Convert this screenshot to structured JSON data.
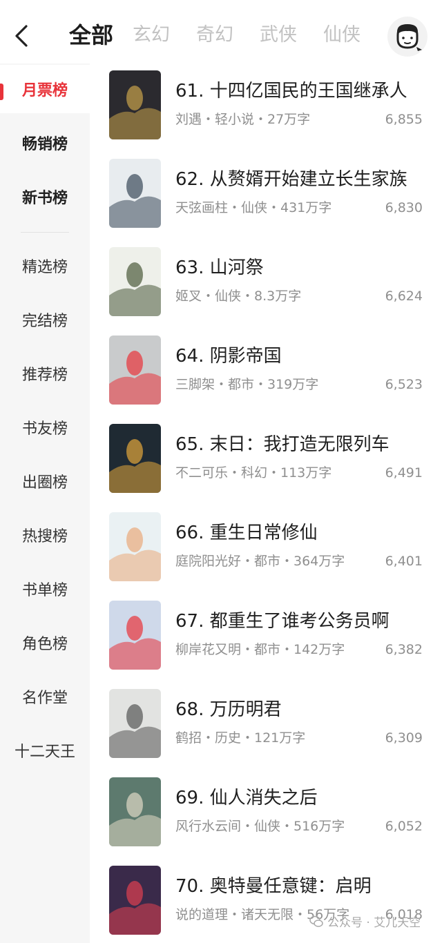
{
  "header": {
    "tabs": [
      {
        "label": "全部",
        "active": true
      },
      {
        "label": "玄幻"
      },
      {
        "label": "奇幻"
      },
      {
        "label": "武侠"
      },
      {
        "label": "仙侠"
      }
    ],
    "back_icon": "chevron-left-icon",
    "avatar_icon": "user-avatar-icon"
  },
  "sidebar": {
    "items": [
      {
        "label": "月票榜",
        "active": true
      },
      {
        "label": "畅销榜"
      },
      {
        "label": "新书榜"
      },
      {
        "label": "精选榜"
      },
      {
        "label": "完结榜"
      },
      {
        "label": "推荐榜"
      },
      {
        "label": "书友榜"
      },
      {
        "label": "出圈榜"
      },
      {
        "label": "热搜榜"
      },
      {
        "label": "书单榜"
      },
      {
        "label": "角色榜"
      },
      {
        "label": "名作堂"
      },
      {
        "label": "十二天王"
      }
    ]
  },
  "books": [
    {
      "title": "61. 十四亿国民的王国继承人",
      "meta": "刘遇・轻小说・27万字",
      "count": "6,855",
      "cover_color": "#2b2a2f",
      "cover_accent": "#c9a24a"
    },
    {
      "title": "62. 从赘婿开始建立长生家族",
      "meta": "天弦画柱・仙侠・431万字",
      "count": "6,830",
      "cover_color": "#e8ecef",
      "cover_accent": "#3a4a5a"
    },
    {
      "title": "63. 山河祭",
      "meta": "姬叉・仙侠・8.3万字",
      "count": "6,624",
      "cover_color": "#eef0ea",
      "cover_accent": "#4b5a3a"
    },
    {
      "title": "64. 阴影帝国",
      "meta": "三脚架・都市・319万字",
      "count": "6,523",
      "cover_color": "#c9cbcc",
      "cover_accent": "#e8333a"
    },
    {
      "title": "65. 末日：我打造无限列车",
      "meta": "不二可乐・科幻・113万字",
      "count": "6,491",
      "cover_color": "#1f2a33",
      "cover_accent": "#e2a63a"
    },
    {
      "title": "66. 重生日常修仙",
      "meta": "庭院阳光好・都市・364万字",
      "count": "6,401",
      "cover_color": "#eaf1f3",
      "cover_accent": "#e9a97a"
    },
    {
      "title": "67. 都重生了谁考公务员啊",
      "meta": "柳岸花又明・都市・142万字",
      "count": "6,382",
      "cover_color": "#cfd9ea",
      "cover_accent": "#e8333a"
    },
    {
      "title": "68. 万历明君",
      "meta": "鹤招・历史・121万字",
      "count": "6,309",
      "cover_color": "#e2e3e1",
      "cover_accent": "#555"
    },
    {
      "title": "69. 仙人消失之后",
      "meta": "风行水云间・仙侠・516万字",
      "count": "6,052",
      "cover_color": "#5d7a6e",
      "cover_accent": "#e0d8c5"
    },
    {
      "title": "70. 奥特曼任意键：启明",
      "meta": "说的道理・诸天无限・56万字",
      "count": "6,018",
      "cover_color": "#3a2a4a",
      "cover_accent": "#e04050"
    }
  ],
  "watermark": {
    "text": "公众号 · 艾儿天空"
  },
  "colors": {
    "accent": "#e8333a",
    "muted": "#8f8f8f",
    "sidebar_bg": "#f6f6f6"
  }
}
